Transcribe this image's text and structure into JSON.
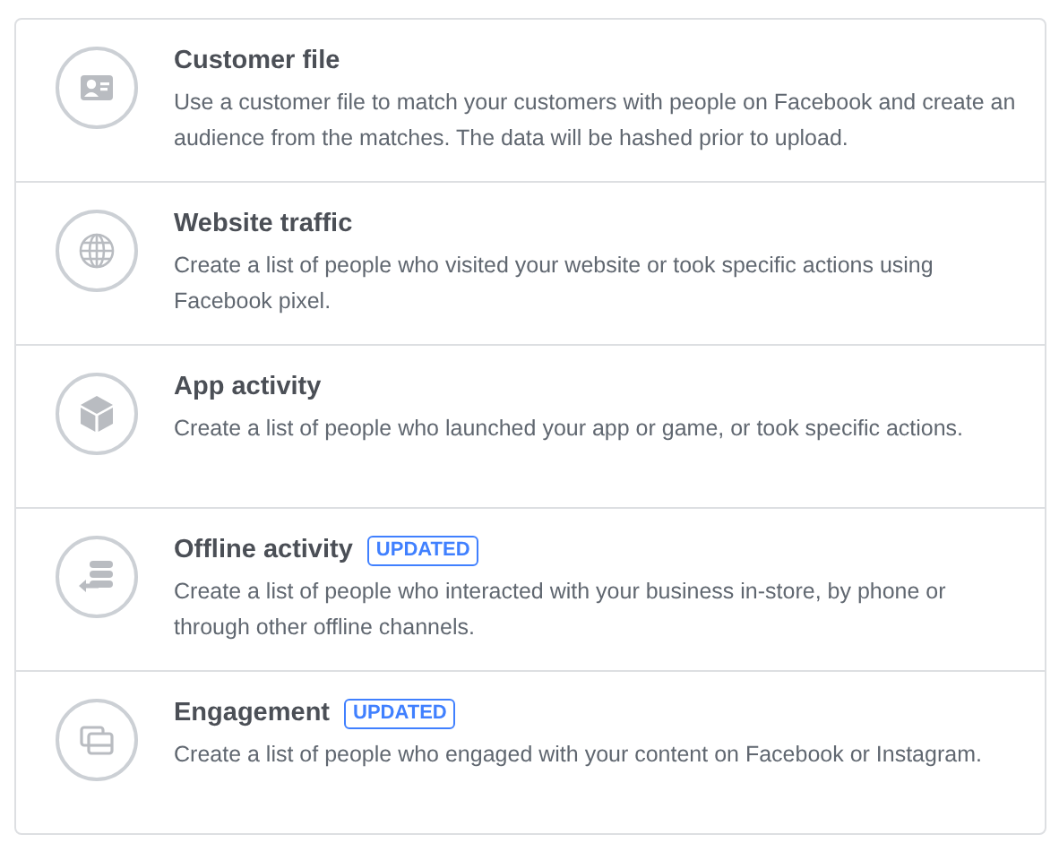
{
  "options": [
    {
      "kind": "customer-file",
      "title": "Customer file",
      "description": "Use a customer file to match your customers with people on Facebook and create an audience from the matches. The data will be hashed prior to upload."
    },
    {
      "kind": "website",
      "title": "Website traffic",
      "description": "Create a list of people who visited your website or took specific actions using Facebook pixel."
    },
    {
      "kind": "app",
      "title": "App activity",
      "description": "Create a list of people who launched your app or game, or took specific actions."
    },
    {
      "kind": "offline",
      "title": "Offline activity",
      "badge": "UPDATED",
      "description": "Create a list of people who interacted with your business in-store, by phone or through other offline channels."
    },
    {
      "kind": "engagement",
      "title": "Engagement",
      "badge": "UPDATED",
      "description": "Create a list of people who engaged with your content on Facebook or Instagram."
    }
  ]
}
